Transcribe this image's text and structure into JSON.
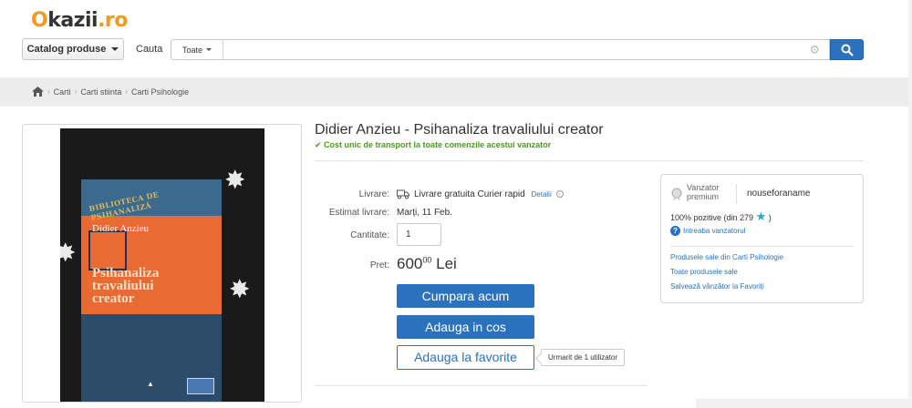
{
  "site": {
    "logo_o": "O",
    "logo_rest": "kazii",
    "logo_tld": ".ro"
  },
  "header": {
    "catalog_label": "Catalog produse",
    "search_label": "Cauta",
    "category_select": "Toate",
    "search_placeholder": ""
  },
  "breadcrumb": [
    "Carti",
    "Carti stiinta",
    "Carti Psihologie"
  ],
  "product": {
    "title": "Didier Anzieu - Psihanaliza travaliului creator",
    "shipping_note": "✔ Cost unic de transport la toate comenzile acestui vanzator",
    "delivery_label": "Livrare:",
    "delivery_value": "Livrare gratuita Curier rapid",
    "details_link": "Detalii",
    "estimate_label": "Estimat livrare:",
    "estimate_value": "Marți, 11 Feb.",
    "quantity_label": "Cantitate:",
    "quantity_value": "1",
    "price_label": "Pret:",
    "price_int": "600",
    "price_dec": "00",
    "currency": "Lei",
    "buy_now": "Cumpara acum",
    "add_to_cart": "Adauga in cos",
    "add_favorite": "Adauga la favorite",
    "followers": "Urmarit de 1 utilizator"
  },
  "book_cover": {
    "series": "BIBLIOTECA DE PSIHANALIZĂ",
    "author": "Didier Anzieu",
    "title_line1": "Psihanaliza",
    "title_line2": "travaliului",
    "title_line3": "creator"
  },
  "seller": {
    "badge_line1": "Vanzator",
    "badge_line2": "premium",
    "name": "nouseforaname",
    "rating_text": "100% pozitive (din 279",
    "rating_end": ")",
    "ask_link": "Intreaba vanzatorul",
    "links": [
      "Produsele sale din Carti Psihologie",
      "Toate produsele sale",
      "Salvează vânzător la Favoriți"
    ]
  },
  "colors": {
    "accent": "#2a72bf",
    "logo": "#f29a1f",
    "success": "#4a9a1e"
  }
}
